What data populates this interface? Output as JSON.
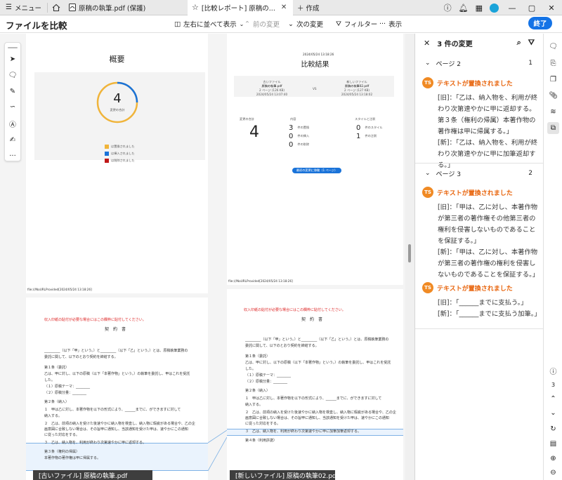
{
  "tabbar": {
    "menu_label": "メニュー",
    "tabs": [
      {
        "title": "原稿の執筆.pdf (保護)"
      },
      {
        "title": "[比較レポート] 原稿の..."
      }
    ],
    "new_tab_label": "作成"
  },
  "toolbar": {
    "title": "ファイルを比較",
    "side_by_side": "左右に並べて表示",
    "prev": "前の変更",
    "next": "次の変更",
    "filter": "フィルター",
    "view": "表示",
    "done": "終了"
  },
  "left_doc": {
    "summary_title": "概要",
    "total_changes": "4",
    "total_label": "変更の合計",
    "legend": [
      "は置換されました",
      "は挿入されました",
      "は削除されました"
    ],
    "footer": "file:///NoURLProvided[2024/05/24 13:18:26]",
    "label": "[古いファイル] 原稿の執筆.pdf",
    "red_line": "収入印紙の貼付が必要な場合にはこの欄枠に貼付してください。",
    "contract": "契　約　書",
    "lines": [
      "_________（以下「甲」という。）と_________（以下「乙」という。）とは、原稿執筆業務の",
      "委託に関して、以下のとおり契約を締結する。",
      "第１条（委託）",
      "乙は、甲に対し、以下の原稿（以下「本著作物」という。）の執筆を委託し、甲はこれを受託",
      "した。",
      "（１）原稿テーマ：________",
      "（２）原稿分量：________",
      "第２条（納入）",
      "１　甲は乙に対し、本著作物を以下の形式により、______までに、ができますに対して",
      "納入する。",
      "２　乙は、前項の納入を受けた後速やかに納入物を検査し、納入物に瑕疵がある場合や、乙の企",
      "画意図に合致しない場合は、その旨甲に通知し、当該通知を受けた甲は、速やかにこの通知",
      "に従った対応をする。",
      "３　乙は、納入物を、利用が終わり次第速やかに甲に返却する。",
      "第３条（権利の帰属）",
      "本著作物の著作権は甲に帰属する。"
    ]
  },
  "right_doc": {
    "timestamp": "2024/05/24 13:18:26",
    "result_title": "比較結果",
    "old_file_head": "古いファイル",
    "old_file_name": "原稿の執筆.pdf",
    "old_file_pages": "2 ページ (126 KB)",
    "old_file_date": "2024/05/24 13:07:40",
    "vs": "VS",
    "new_file_head": "新しいファイル",
    "new_file_name": "原稿の執筆02.pdf",
    "new_file_pages": "2 ページ (127 KB)",
    "new_file_date": "2024/05/24 13:18:02",
    "total_head": "変更の合計",
    "total": "4",
    "content_head": "内容",
    "content": [
      {
        "n": "3",
        "label": "件の置換"
      },
      {
        "n": "0",
        "label": "件の挿入"
      },
      {
        "n": "0",
        "label": "件の削除"
      }
    ],
    "style_head": "スタイルと注釈",
    "style": [
      {
        "n": "0",
        "label": "件のスタイル"
      },
      {
        "n": "1",
        "label": "件の注釈"
      }
    ],
    "goto_first": "最初の変更に移動（1 ページ）",
    "footer": "file:///NoURLProvided[2024/05/24 13:18:26]",
    "label": "[新しいファイル] 原稿の執筆02.pdf",
    "red_line": "収入印紙の貼付が必要な場合にはこの欄枠に貼付してください。",
    "contract": "契　約　書",
    "lines": [
      "_________（以下「甲」という。）と_________（以下「乙」という。）とは、原稿執筆業務の",
      "委託に関して、以下のとおり契約を締結する。",
      "第１条（委託）",
      "乙は、甲に対し、以下の原稿（以下「本著作物」という。）の執筆を委託し、甲はこれを受託",
      "した。",
      "（１）原稿テーマ：________",
      "（２）原稿分量：________",
      "第２条（納入）",
      "１　甲は乙に対し、本著作物を以下の形式により、______までに、ができますに対して",
      "納入する。",
      "２　乙は、前項の納入を受けた後速やかに納入物を検査し、納入物に瑕疵がある場合や、乙の企",
      "画意図に合致しない場合は、その旨甲に通知し、当該通知を受けた甲は、速やかにこの通知",
      "に従った対応をする。",
      "３　乙は、納入物を、利用が終わり次第速やかに甲に加筆加筆返却する。",
      "第４条（利用許諾）"
    ]
  },
  "changes_panel": {
    "header": "3 件の変更",
    "page2": "ページ 2",
    "page2_count": "1",
    "page3": "ページ 3",
    "page3_count": "2",
    "change_title": "テキストが置換されました",
    "avatar": "TS",
    "c1_old": "[旧]：「乙は、納入物を、利用が終わり次第速やかに甲に返却する。第３条（権利の帰属）本著作物の著作権は甲に帰属する。」",
    "c1_new": "[新]：「乙は、納入物を、利用が終わり次第速やかに甲に加筆返却する。」",
    "c2_old": "[旧]：「甲は、乙に対し、本著作物が第三者の著作権その他第三者の権利を侵害しないものであること を保証する。」",
    "c2_new": "[新]：「甲は、乙に対し、本著作物が第三者の著作権の権利を侵害しないものであることを保証する。」",
    "c3_old": "[旧]：「______までに支払う。」",
    "c3_new": "[新]：「______までに支払う加筆。」"
  },
  "rail": {
    "page_number": "3"
  }
}
